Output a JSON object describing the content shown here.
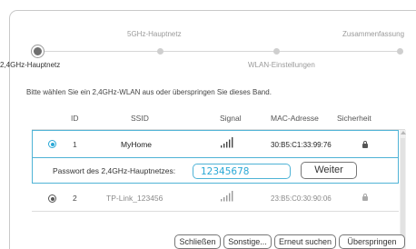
{
  "steps": [
    {
      "label": "2,4GHz-Hauptnetz",
      "state": "active"
    },
    {
      "label": "5GHz-Hauptnetz",
      "state": "pending"
    },
    {
      "label": "WLAN-Einstellungen",
      "state": "pending"
    },
    {
      "label": "Zusammenfassung",
      "state": "pending"
    }
  ],
  "instruction": "Bitte wählen Sie ein 2,4GHz-WLAN aus oder überspringen Sie dieses Band.",
  "table": {
    "headers": {
      "id": "ID",
      "ssid": "SSID",
      "signal": "Signal",
      "mac": "MAC-Adresse",
      "security": "Sicherheit"
    },
    "rows": [
      {
        "id": "1",
        "ssid": "MyHome",
        "signal_bars": 5,
        "mac": "30:B5:C1:33:99:76",
        "secured": true,
        "selected": true
      },
      {
        "id": "2",
        "ssid": "TP-Link_123456",
        "signal_bars": 5,
        "mac": "23:B5:C0:30:90:06",
        "secured": true,
        "selected": false
      }
    ]
  },
  "password": {
    "label": "Passwort des 2,4GHz-Hauptnetzes:",
    "value": "12345678",
    "button": "Weiter"
  },
  "footer": {
    "close": "Schließen",
    "other": "Sonstige...",
    "rescan": "Erneut suchen",
    "skip": "Überspringen"
  },
  "colors": {
    "accent": "#2aa8d6",
    "text": "#333333",
    "muted": "#9a9a9a"
  }
}
